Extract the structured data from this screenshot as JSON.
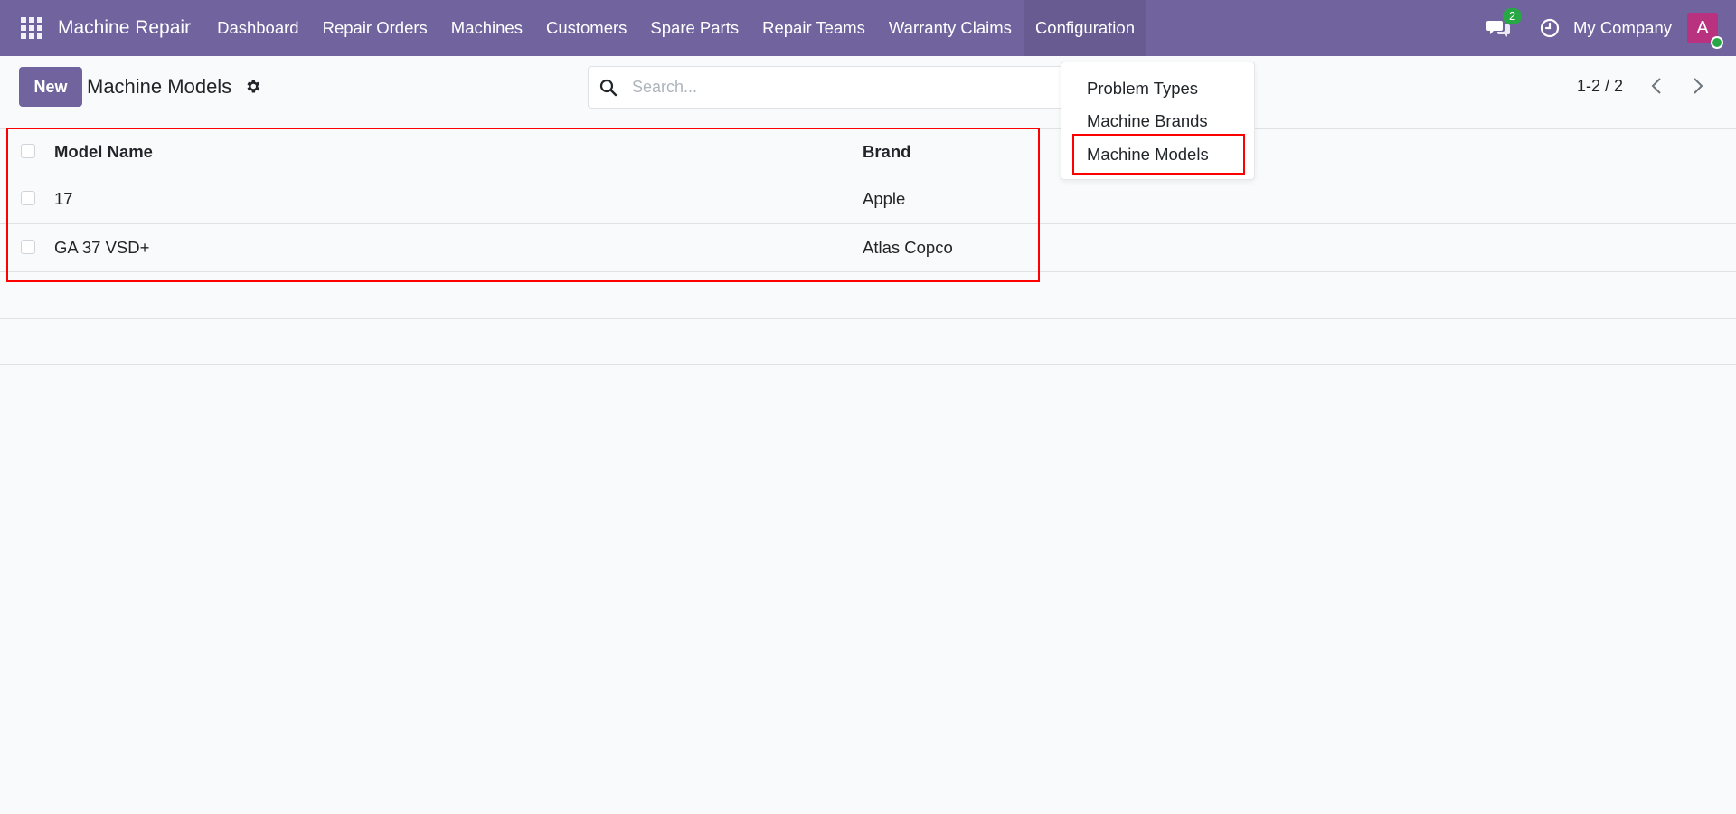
{
  "navbar": {
    "app_name": "Machine Repair",
    "menu": [
      "Dashboard",
      "Repair Orders",
      "Machines",
      "Customers",
      "Spare Parts",
      "Repair Teams",
      "Warranty Claims",
      "Configuration"
    ],
    "active_menu": "Configuration",
    "messages_count": "2",
    "company": "My Company",
    "avatar_letter": "A",
    "colors": {
      "navbar": "#71639e",
      "badge": "#28a745",
      "avatar": "#b83280"
    }
  },
  "control_panel": {
    "new_label": "New",
    "title": "Machine Models",
    "search_placeholder": "Search...",
    "pager": "1-2 / 2"
  },
  "list": {
    "columns": [
      "Model Name",
      "Brand"
    ],
    "rows": [
      {
        "model_name": "17",
        "brand": "Apple"
      },
      {
        "model_name": "GA 37 VSD+",
        "brand": "Atlas Copco"
      }
    ]
  },
  "dropdown": {
    "items": [
      "Problem Types",
      "Machine Brands",
      "Machine Models"
    ],
    "highlighted": "Machine Models"
  },
  "icons": [
    "apps-grid-icon",
    "chat-icon",
    "clock-icon",
    "gear-icon",
    "search-icon",
    "chevron-left-icon",
    "chevron-right-icon"
  ]
}
